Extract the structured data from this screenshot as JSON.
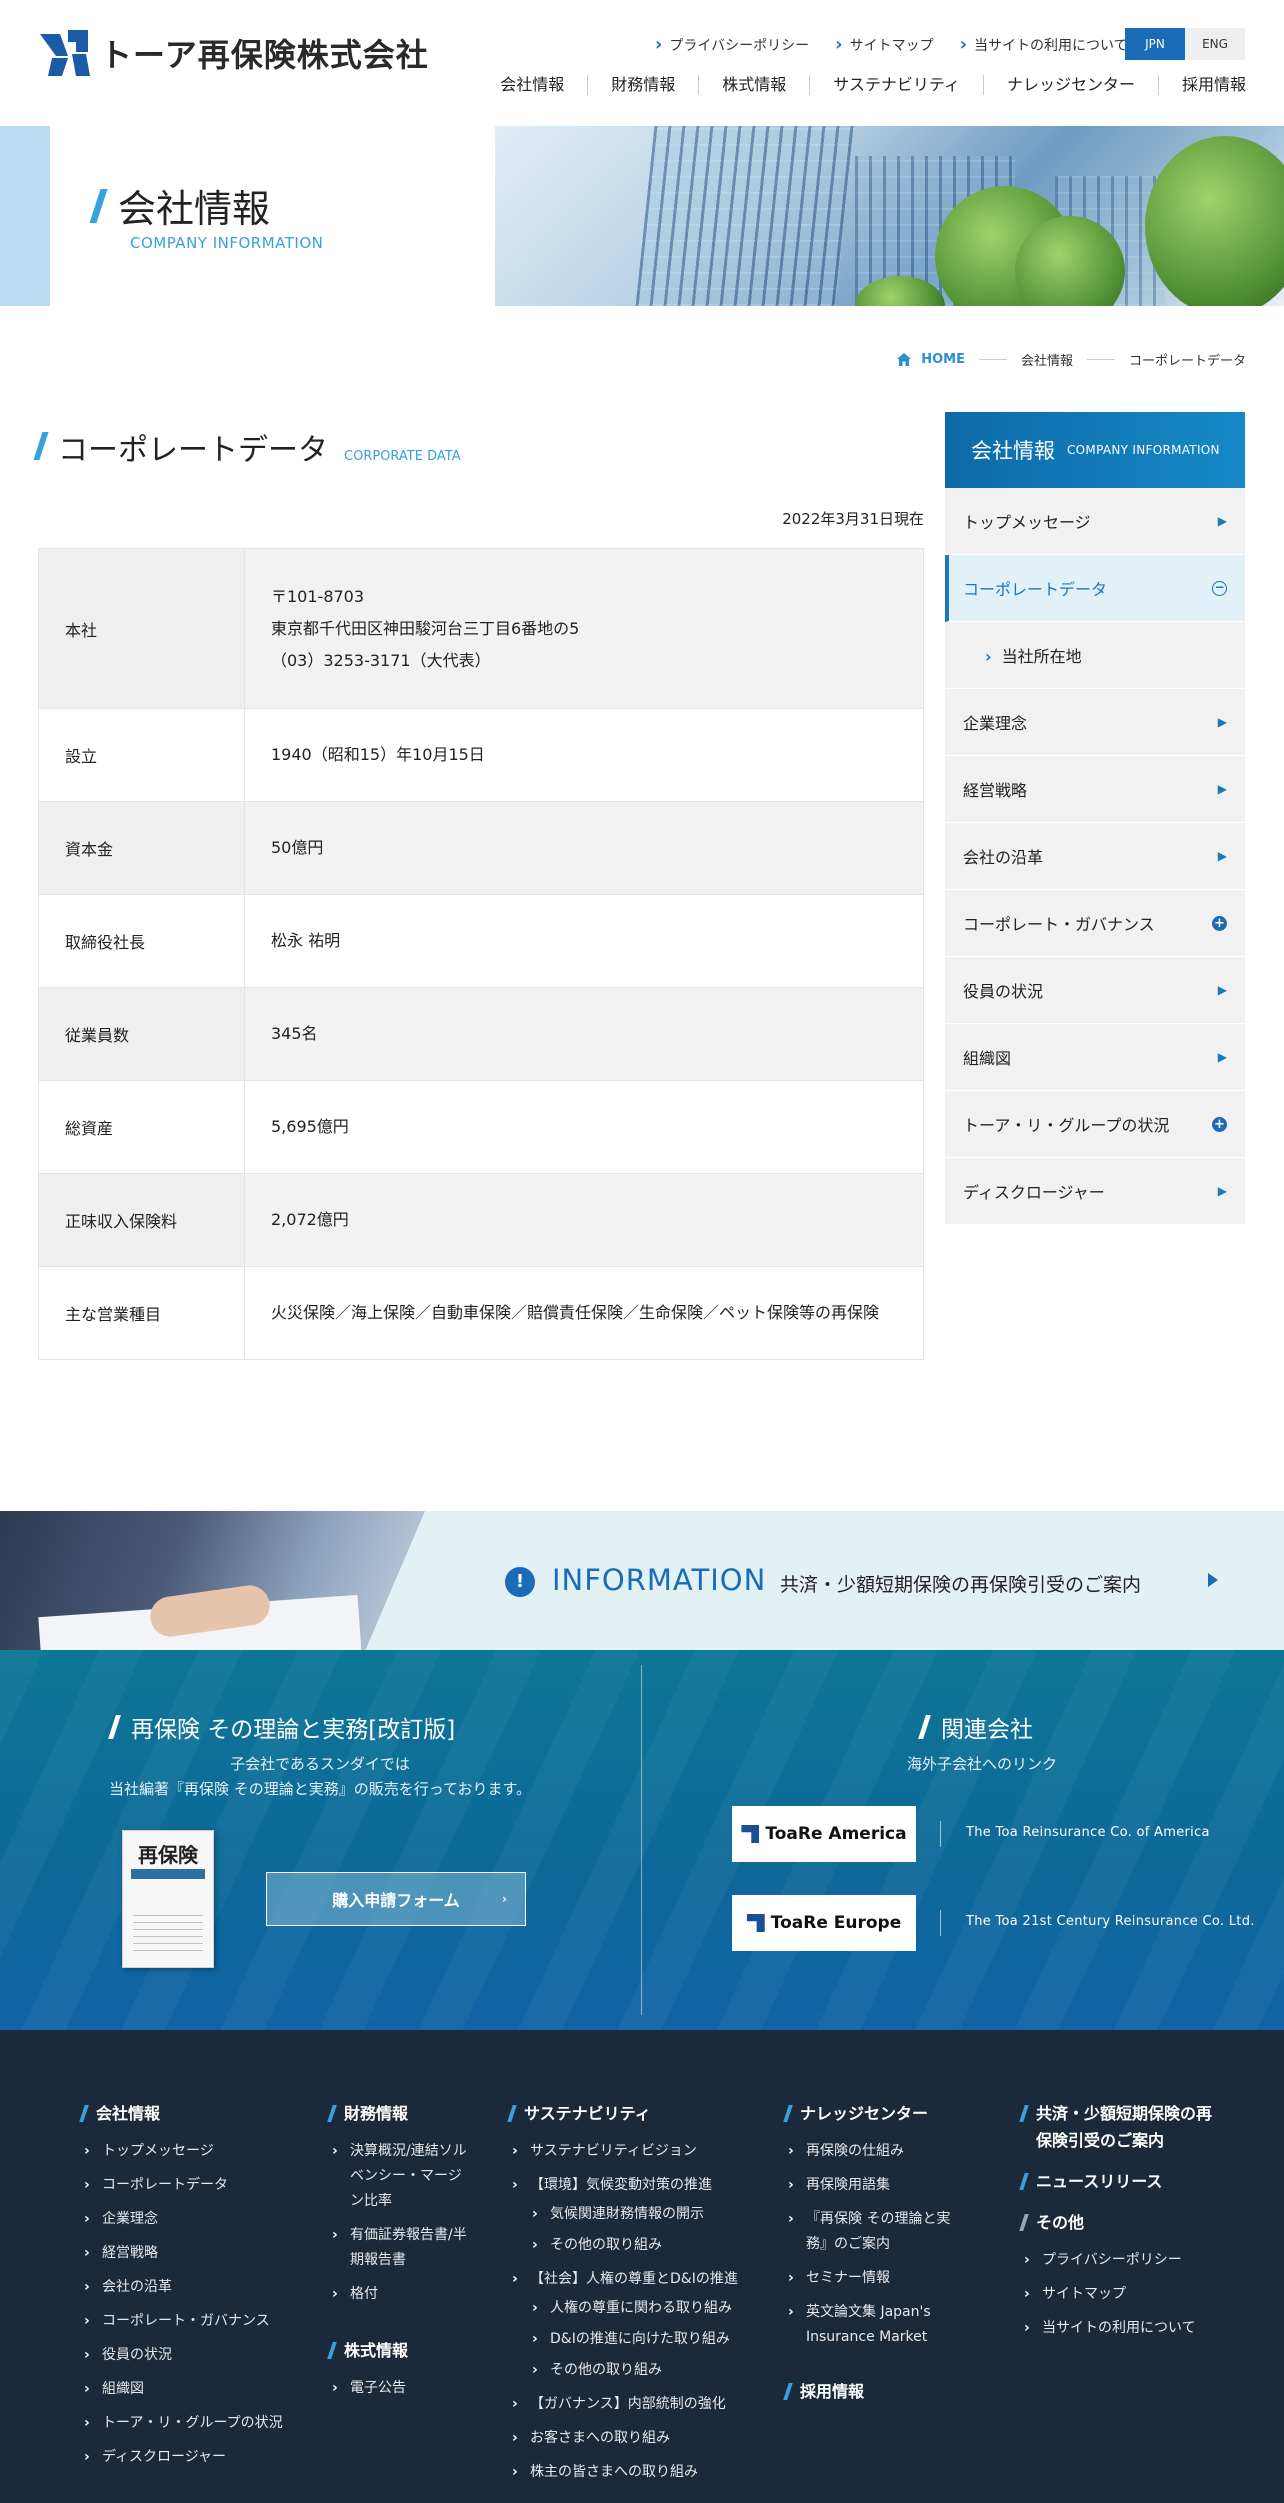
{
  "header": {
    "logo_text": "トーア再保険株式会社",
    "util_links": [
      "プライバシーポリシー",
      "サイトマップ",
      "当サイトの利用について"
    ],
    "lang_jpn": "JPN",
    "lang_eng": "ENG",
    "gnav": [
      "会社情報",
      "財務情報",
      "株式情報",
      "サステナビリティ",
      "ナレッジセンター",
      "採用情報"
    ]
  },
  "hero": {
    "title": "会社情報",
    "subtitle": "COMPANY INFORMATION"
  },
  "breadcrumb": {
    "home": "HOME",
    "level1": "会社情報",
    "level2": "コーポレートデータ"
  },
  "main": {
    "heading": "コーポレートデータ",
    "heading_en": "CORPORATE DATA",
    "as_of": "2022年3月31日現在",
    "rows": [
      {
        "key": "本社",
        "lines": [
          "〒101-8703",
          "東京都千代田区神田駿河台三丁目6番地の5",
          "（03）3253-3171（大代表）"
        ]
      },
      {
        "key": "設立",
        "lines": [
          "1940（昭和15）年10月15日"
        ]
      },
      {
        "key": "資本金",
        "lines": [
          "50億円"
        ]
      },
      {
        "key": "取締役社長",
        "lines": [
          "松永 祐明"
        ]
      },
      {
        "key": "従業員数",
        "lines": [
          "345名"
        ]
      },
      {
        "key": "総資産",
        "lines": [
          "5,695億円"
        ]
      },
      {
        "key": "正味収入保険料",
        "lines": [
          "2,072億円"
        ]
      },
      {
        "key": "主な営業種目",
        "lines": [
          "火災保険／海上保険／自動車保険／賠償責任保険／生命保険／ペット保険等の再保険"
        ]
      }
    ]
  },
  "sidebar": {
    "title": "会社情報",
    "title_en": "COMPANY INFORMATION",
    "items": [
      {
        "label": "トップメッセージ",
        "icon": "arrow"
      },
      {
        "label": "コーポレートデータ",
        "icon": "minus",
        "active": true
      },
      {
        "label": "当社所在地",
        "icon": "none",
        "sub": true
      },
      {
        "label": "企業理念",
        "icon": "arrow"
      },
      {
        "label": "経営戦略",
        "icon": "arrow"
      },
      {
        "label": "会社の沿革",
        "icon": "arrow"
      },
      {
        "label": "コーポレート・ガバナンス",
        "icon": "plus"
      },
      {
        "label": "役員の状況",
        "icon": "arrow"
      },
      {
        "label": "組織図",
        "icon": "arrow"
      },
      {
        "label": "トーア・リ・グループの状況",
        "icon": "plus"
      },
      {
        "label": "ディスクロージャー",
        "icon": "arrow"
      }
    ]
  },
  "info": {
    "label": "INFORMATION",
    "text": "共済・少額短期保険の再保険引受のご案内"
  },
  "book_section": {
    "title": "再保険 その理論と実務[改訂版]",
    "desc1": "子会社であるスンダイでは",
    "desc2": "当社編著『再保険 その理論と実務』の販売を行っております。",
    "book_title": "再保険",
    "button": "購入申請フォーム"
  },
  "related": {
    "title": "関連会社",
    "sub": "海外子会社へのリンク",
    "companies": [
      {
        "logo": "ToaRe America",
        "name": "The Toa Reinsurance Co. of America"
      },
      {
        "logo": "ToaRe Europe",
        "name": "The Toa 21st Century Reinsurance Co. Ltd."
      }
    ]
  },
  "footer": {
    "col1": {
      "title": "会社情報",
      "links": [
        "トップメッセージ",
        "コーポレートデータ",
        "企業理念",
        "経営戦略",
        "会社の沿革",
        "コーポレート・ガバナンス",
        "役員の状況",
        "組織図",
        "トーア・リ・グループの状況",
        "ディスクロージャー"
      ]
    },
    "col2": {
      "title": "財務情報",
      "links": [
        "決算概況/連結ソルベンシー・マージン比率",
        "有価証券報告書/半期報告書",
        "格付"
      ],
      "title2": "株式情報",
      "links2": [
        "電子公告"
      ]
    },
    "col3": {
      "title": "サステナビリティ",
      "links": [
        "サステナビリティビジョン",
        "【環境】気候変動対策の推進",
        "気候関連財務情報の開示",
        "その他の取り組み",
        "【社会】人権の尊重とD&Iの推進",
        "人権の尊重に関わる取り組み",
        "D&Iの推進に向けた取り組み",
        "その他の取り組み",
        "【ガバナンス】内部統制の強化",
        "お客さまへの取り組み",
        "株主の皆さまへの取り組み"
      ]
    },
    "col4": {
      "title": "ナレッジセンター",
      "links": [
        "再保険の仕組み",
        "再保険用語集",
        "『再保険 その理論と実務』のご案内",
        "セミナー情報",
        "英文論文集 Japan's Insurance Market"
      ],
      "title2": "採用情報"
    },
    "col5": {
      "title": "共済・少額短期保険の再保険引受のご案内",
      "title2": "ニュースリリース",
      "title3": "その他",
      "links": [
        "プライバシーポリシー",
        "サイトマップ",
        "当サイトの利用について"
      ]
    }
  }
}
